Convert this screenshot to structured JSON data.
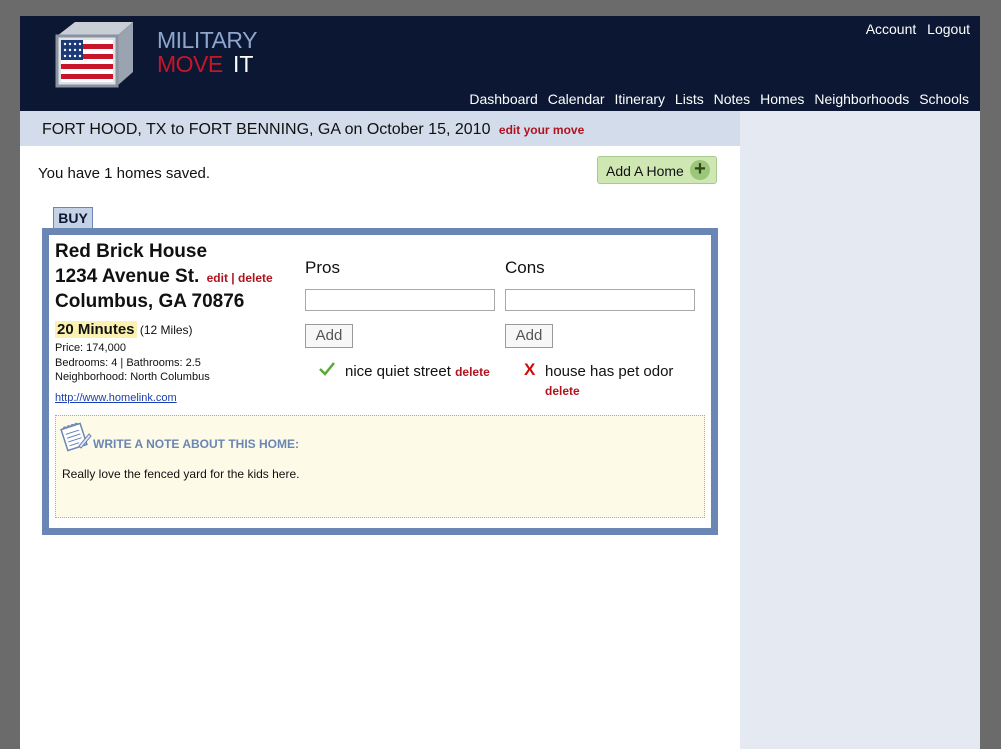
{
  "brand": {
    "military": "MILITARY",
    "move": "MOVE",
    "it": "IT"
  },
  "account": {
    "account_label": "Account",
    "logout_label": "Logout"
  },
  "nav": [
    "Dashboard",
    "Calendar",
    "Itinerary",
    "Lists",
    "Notes",
    "Homes",
    "Neighborhoods",
    "Schools"
  ],
  "move": {
    "summary": "FORT HOOD, TX to FORT BENNING, GA on October 15, 2010",
    "edit_label": "edit your move"
  },
  "homes": {
    "saved_text": "You have 1 homes saved.",
    "add_button_label": "Add A Home",
    "add_icon": "plus-icon"
  },
  "buy_tab": "BUY",
  "home": {
    "name": "Red Brick House",
    "street": "1234 Avenue St.",
    "city": "Columbus, GA 70876",
    "edit_label": "edit",
    "separator": "|",
    "delete_label": "delete",
    "commute_time": "20 Minutes",
    "commute_distance": "(12 Miles)",
    "price": "Price: 174,000",
    "rooms": "Bedrooms: 4 | Bathrooms: 2.5",
    "neighborhood": "Neighborhood: North Columbus",
    "link": "http://www.homelink.com"
  },
  "pros": {
    "title": "Pros",
    "input_value": "",
    "add_label": "Add",
    "items": [
      {
        "text": "nice quiet street",
        "delete_label": "delete"
      }
    ]
  },
  "cons": {
    "title": "Cons",
    "input_value": "",
    "add_label": "Add",
    "items": [
      {
        "text": "house has pet odor",
        "delete_label": "delete"
      }
    ]
  },
  "notes": {
    "heading": "WRITE A NOTE ABOUT THIS HOME:",
    "text": "Really love the fenced yard for the kids here."
  },
  "colors": {
    "header_bg": "#0b1733",
    "accent_blue": "#6a86b5",
    "delete_red": "#b1121e",
    "add_green": "#cfe7b3"
  }
}
